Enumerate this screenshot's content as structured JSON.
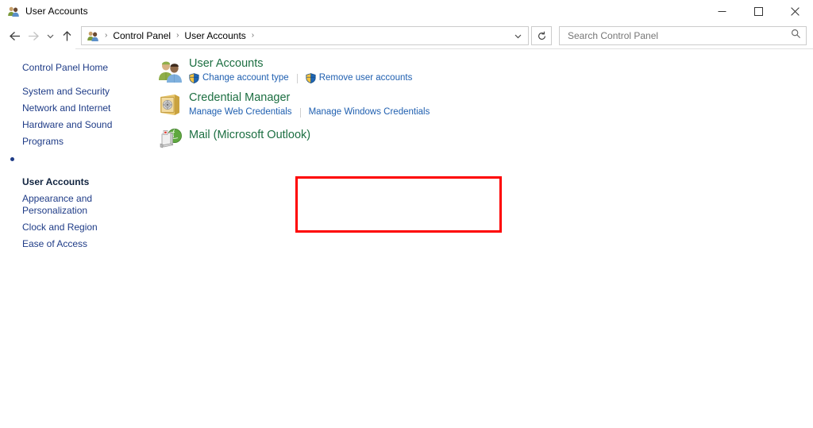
{
  "window": {
    "title": "User Accounts",
    "title_icon": "user-accounts-icon",
    "minimize_label": "Minimize",
    "maximize_label": "Maximize",
    "close_label": "Close"
  },
  "toolbar": {
    "back_label": "Back",
    "forward_label": "Forward",
    "recent_label": "Recent locations",
    "up_label": "Up",
    "refresh_label": "Refresh",
    "breadcrumb": [
      {
        "label": "Control Panel"
      },
      {
        "label": "User Accounts"
      }
    ],
    "breadcrumb_separator": "›",
    "address_chevron": "chevron-down-icon"
  },
  "search": {
    "placeholder": "Search Control Panel",
    "value": "",
    "icon": "search-icon"
  },
  "sidebar": {
    "items": [
      {
        "label": "Control Panel Home",
        "current": false,
        "home": true
      },
      {
        "label": "System and Security",
        "current": false
      },
      {
        "label": "Network and Internet",
        "current": false
      },
      {
        "label": "Hardware and Sound",
        "current": false
      },
      {
        "label": "Programs",
        "current": false
      },
      {
        "label": "User Accounts",
        "current": true
      },
      {
        "label": "Appearance and\nPersonalization",
        "current": false
      },
      {
        "label": "Clock and Region",
        "current": false
      },
      {
        "label": "Ease of Access",
        "current": false
      }
    ]
  },
  "main": {
    "categories": [
      {
        "title": "User Accounts",
        "icon": "user-accounts-icon",
        "links": [
          {
            "label": "Change account type",
            "shield": true
          },
          {
            "label": "Remove user accounts",
            "shield": true
          }
        ]
      },
      {
        "title": "Credential Manager",
        "icon": "credential-vault-icon",
        "links": [
          {
            "label": "Manage Web Credentials",
            "shield": false
          },
          {
            "label": "Manage Windows Credentials",
            "shield": false
          }
        ]
      },
      {
        "title": "Mail (Microsoft Outlook)",
        "icon": "mail-outlook-icon",
        "links": []
      }
    ]
  },
  "annotation": {
    "target": "Mail (Microsoft Outlook)",
    "color": "#fe0000"
  },
  "colors": {
    "heading_green": "#1d6f42",
    "link_blue": "#1f5fb0",
    "sidebar_blue": "#1f3c87",
    "annotation_red": "#fe0000"
  }
}
